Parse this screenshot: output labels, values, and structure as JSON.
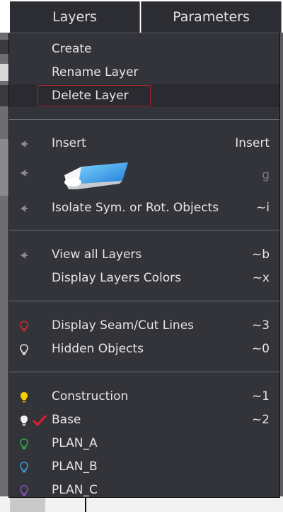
{
  "tabs": [
    {
      "label": "Layers"
    },
    {
      "label": "Parameters"
    }
  ],
  "menu": {
    "group1": [
      {
        "label": "Create"
      },
      {
        "label": "Rename Layer"
      },
      {
        "label": "Delete Layer"
      }
    ],
    "insert": {
      "label": "Insert",
      "shortcut": "Insert"
    },
    "eraser": {
      "icon": "eraser-icon",
      "shortcut": "g"
    },
    "isolate": {
      "label": "Isolate Sym. or Rot. Objects",
      "shortcut": "~i"
    },
    "view_all": {
      "label": "View all Layers",
      "shortcut": "~b"
    },
    "display_colors": {
      "label": "Display Layers Colors",
      "shortcut": "~x"
    },
    "seam": {
      "label": "Display Seam/Cut Lines",
      "shortcut": "~3",
      "icon": "lightbulb-outline-red-icon"
    },
    "hidden": {
      "label": "Hidden Objects",
      "shortcut": "~0",
      "icon": "lightbulb-outline-white-icon"
    },
    "layers": [
      {
        "label": "Construction",
        "shortcut": "~1",
        "icon": "lightbulb-yellow-icon"
      },
      {
        "label": "Base",
        "shortcut": "~2",
        "icon": "lightbulb-white-icon",
        "checked": true
      },
      {
        "label": "PLAN_A",
        "icon": "lightbulb-outline-green-icon"
      },
      {
        "label": "PLAN_B",
        "icon": "lightbulb-outline-blue-icon"
      },
      {
        "label": "PLAN_C",
        "icon": "lightbulb-outline-purple-icon"
      }
    ]
  },
  "colors": {
    "menu_bg": "#33333a",
    "highlight_border": "#a02832",
    "check": "#e0202a",
    "yellow": "#f5d000",
    "green": "#2fa84a",
    "blue": "#3a9bd8",
    "purple": "#8a4fc0",
    "red": "#d02a2a"
  }
}
